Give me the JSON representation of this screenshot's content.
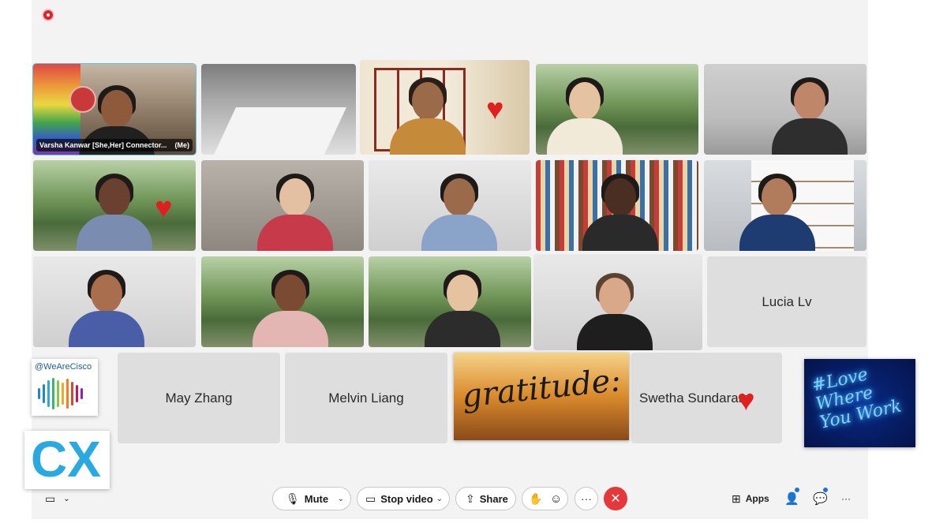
{
  "recording_indicator": "recording",
  "participants": [
    {
      "name": "Varsha Kanwar [She,Her] Connector...",
      "me_label": "(Me)"
    },
    {
      "name": ""
    },
    {
      "name": ""
    },
    {
      "name": ""
    },
    {
      "name": ""
    }
  ],
  "empty_tiles": [
    {
      "name": "Lucia Lv"
    },
    {
      "name": "May Zhang"
    },
    {
      "name": "Melvin Liang"
    },
    {
      "name": "Swetha Sundarara"
    }
  ],
  "stickers": {
    "we_are_cisco": "@WeAreCisco",
    "cx_logo": "CX",
    "gratitude": "gratitude:",
    "neon": "#Love Where You Work"
  },
  "toolbar": {
    "mute_label": "Mute",
    "stop_video_label": "Stop video",
    "share_label": "Share",
    "apps_label": "Apps",
    "more_label": "···"
  },
  "icons": {
    "reaction": "heart",
    "mute": "microphone-icon",
    "video": "video-camera-icon",
    "share": "share-screen-icon",
    "raise_hand": "raise-hand-icon",
    "emoji": "smiley-icon",
    "end": "close-icon",
    "apps": "apps-grid-icon",
    "participants": "participants-icon",
    "chat": "chat-icon"
  },
  "colors": {
    "end_call": "#e5383b",
    "self_view_border": "#5ec2e8",
    "badge": "#1e73e8",
    "heart": "#e0201f"
  }
}
